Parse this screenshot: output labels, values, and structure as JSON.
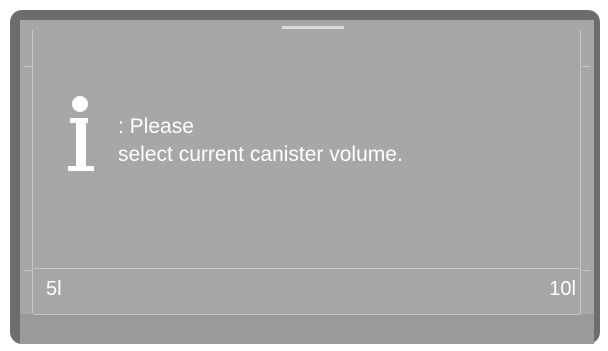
{
  "display": {
    "message": {
      "line1": ": Please",
      "line2": "select current canister volume."
    },
    "icon": "info-icon",
    "scale": {
      "min_label": "5l",
      "max_label": "10l"
    }
  },
  "colors": {
    "frame": "#6d6d6d",
    "screen": "#a7a7a7",
    "text": "#ffffff"
  }
}
